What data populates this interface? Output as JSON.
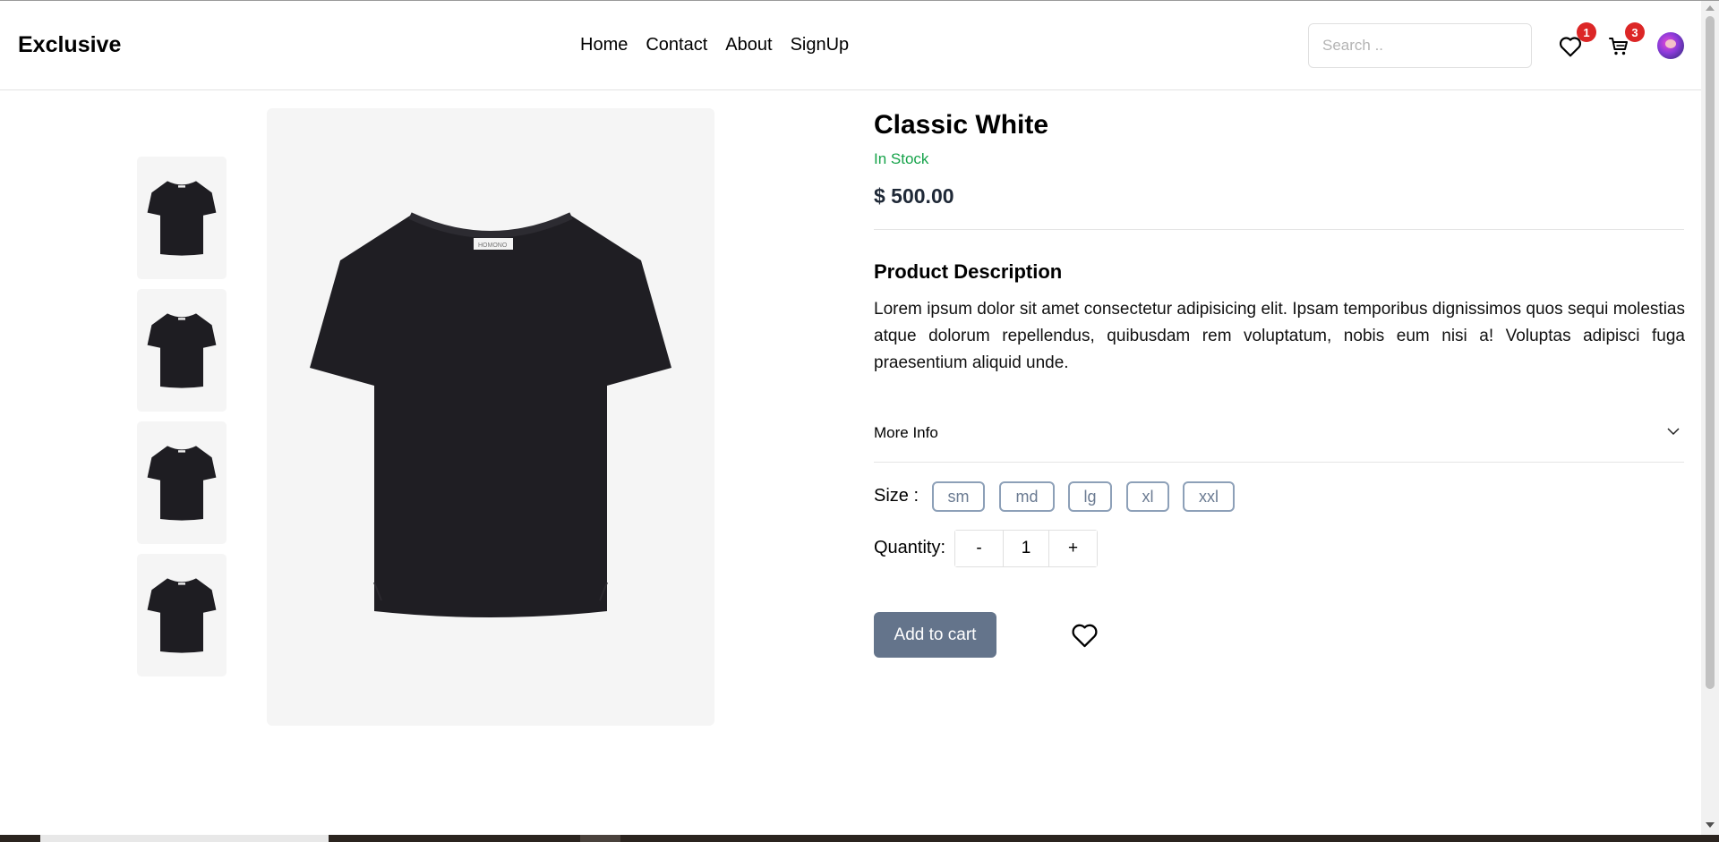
{
  "header": {
    "logo": "Exclusive",
    "nav": [
      "Home",
      "Contact",
      "About",
      "SignUp"
    ],
    "search_placeholder": "Search ..",
    "wishlist_count": "1",
    "cart_count": "3"
  },
  "product": {
    "title": "Classic White",
    "stock": "In Stock",
    "price": "$ 500.00",
    "description_title": "Product Description",
    "description": "Lorem ipsum dolor sit amet consectetur adipisicing elit. Ipsam temporibus dignissimos quos sequi molestias atque dolorum repellendus, quibusdam rem voluptatum, nobis eum nisi a! Voluptas adipisci fuga praesentium aliquid unde.",
    "more_info_label": "More Info",
    "size_label": "Size :",
    "sizes": [
      "sm",
      "md",
      "lg",
      "xl",
      "xxl"
    ],
    "quantity_label": "Quantity:",
    "quantity_minus": "-",
    "quantity_value": "1",
    "quantity_plus": "+",
    "add_to_cart": "Add to cart",
    "tshirt_tag": "HOMONO"
  },
  "icons": {
    "wishlist": "heart-icon",
    "cart": "cart-icon",
    "more_info": "chevron-down-icon",
    "add_wish": "heart-icon"
  },
  "colors": {
    "in_stock": "#16a34a",
    "badge": "#dc2626",
    "add_to_cart_bg": "#64748b",
    "size_border": "#8da0b8"
  }
}
